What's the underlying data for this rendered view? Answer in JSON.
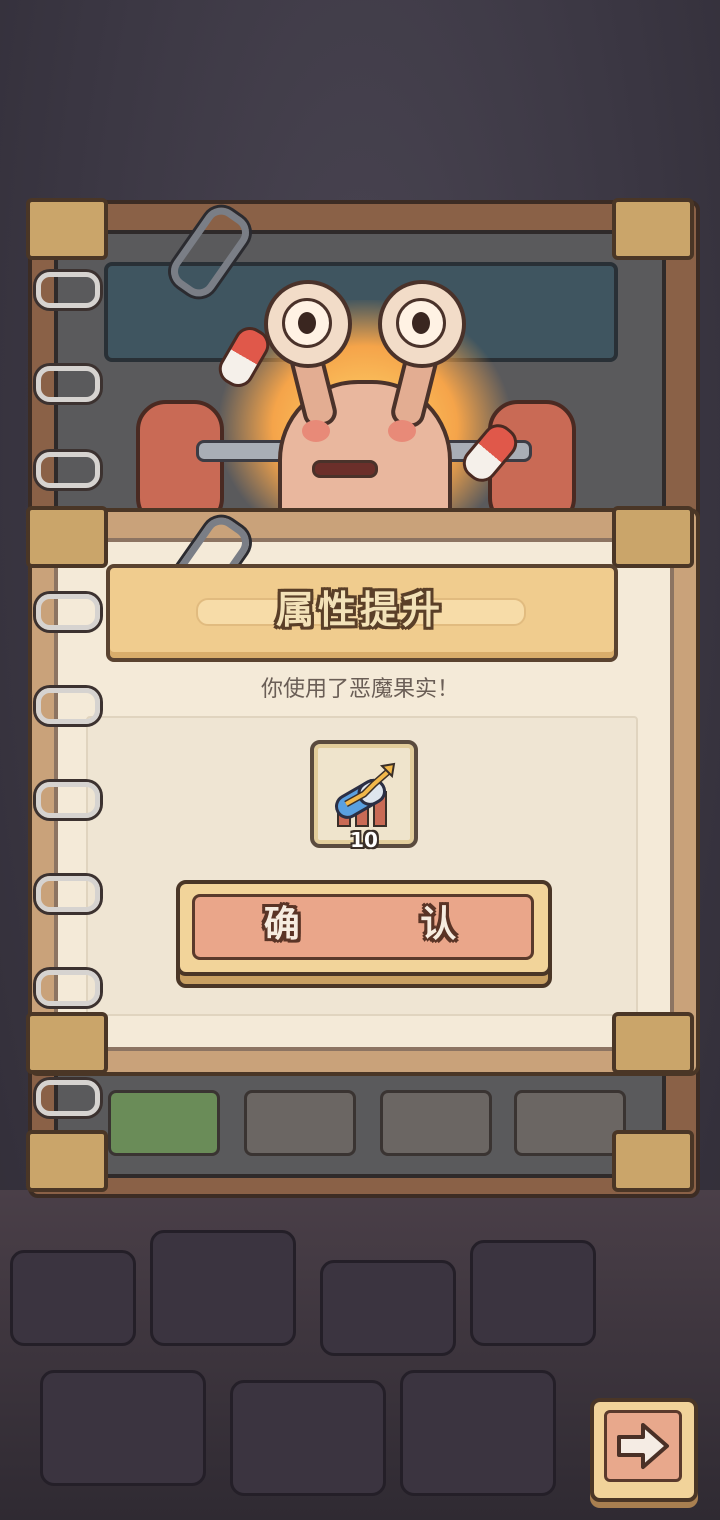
{
  "dialog": {
    "title": "属性提升",
    "message": "你使用了恶魔果实！",
    "item": {
      "icon": "pill-upgrade-arrow-icon",
      "count": "10"
    },
    "confirm_label": "确 认"
  },
  "navigation": {
    "next_icon": "arrow-right-icon"
  },
  "colors": {
    "banner": "#f0cc8e",
    "confirm": "#eaa68a",
    "page": "#f4ead8"
  }
}
